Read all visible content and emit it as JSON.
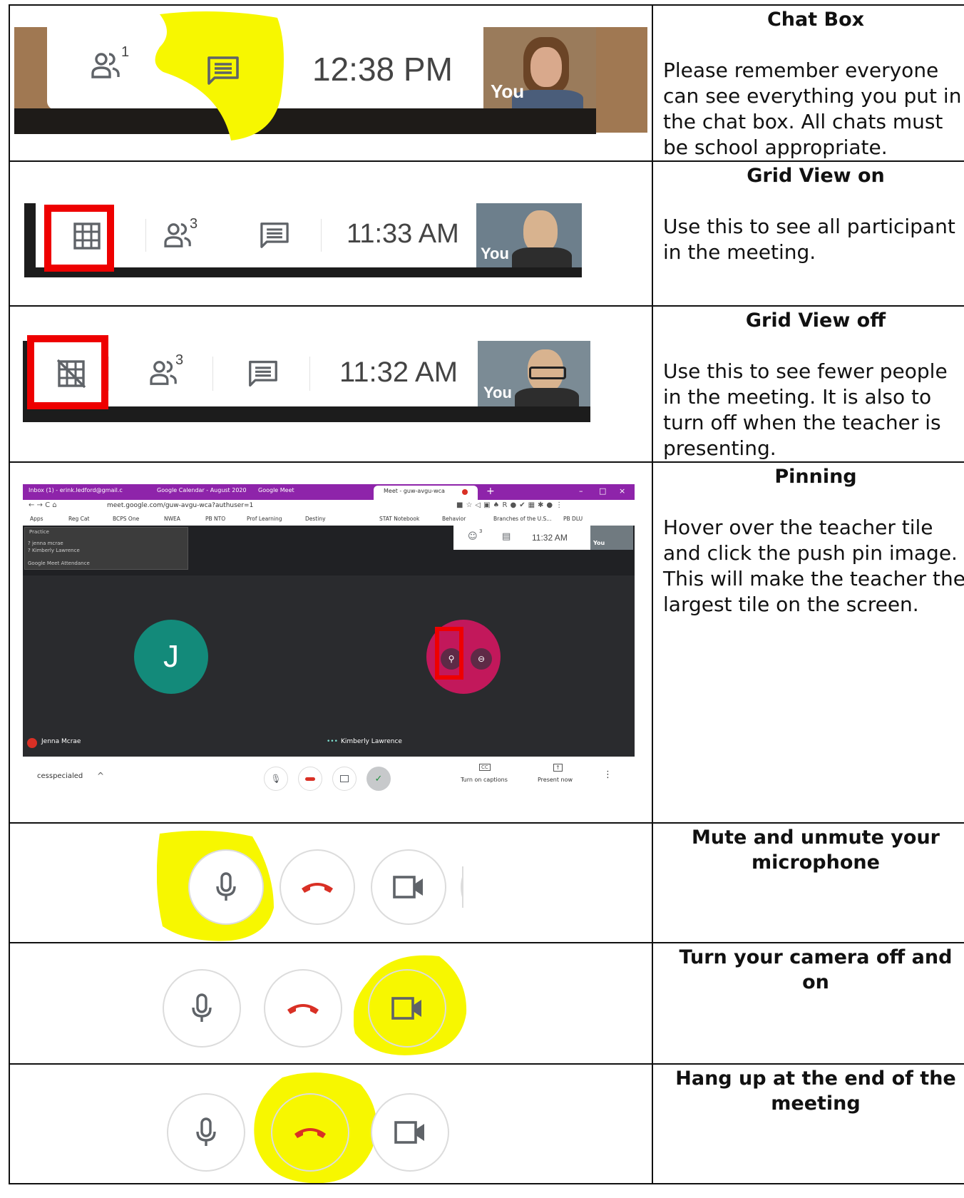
{
  "rows": [
    {
      "title": "Chat Box",
      "description": "Please remember everyone can see everything you put in the chat box.  All chats must be school appropriate.",
      "screenshot": {
        "participant_count": "1",
        "time": "12:38  PM",
        "self_label": "You"
      }
    },
    {
      "title": "Grid View on",
      "description": "Use this to see all participant in the meeting.",
      "screenshot": {
        "participant_count": "3",
        "time": "11:33  AM",
        "self_label": "You"
      }
    },
    {
      "title": "Grid View off",
      "description": "Use this to see fewer people in the meeting.  It is also to turn off when the teacher is presenting.",
      "screenshot": {
        "participant_count": "3",
        "time": "11:32  AM",
        "self_label": "You"
      }
    },
    {
      "title": "Pinning",
      "description": "Hover over the teacher tile and click the push pin image.  This will make the teacher the largest tile on the screen.",
      "screenshot": {
        "tabs": [
          "Inbox (1) - erink.ledford@gmail.c",
          "Google Calendar - August 2020",
          "Google Meet",
          "Meet - guw-avgu-wca"
        ],
        "url": "meet.google.com/guw-avgu-wca?authuser=1",
        "bookmarks": [
          "Apps",
          "Reg Cat",
          "BCPS One",
          "NWEA",
          "PB NTO",
          "Prof Learning",
          "Destiny",
          "STAT Notebook",
          "Behavior",
          "Branches of the U.S...",
          "PB DLU"
        ],
        "attendance_panel": [
          "Practice",
          "? jenna mcrae",
          "? Kimberly Lawrence",
          "Google Meet Attendance"
        ],
        "participant_count": "3",
        "time": "11:32  AM",
        "self_label": "You",
        "tile_left_initial": "J",
        "name_left": "Jenna Mcrae",
        "name_right": "Kimberly Lawrence",
        "meeting_name": "cesspecialed",
        "caption_label": "Turn on captions",
        "present_label": "Present now",
        "cc_label": "CC"
      }
    },
    {
      "title": "Mute and unmute your microphone",
      "description": ""
    },
    {
      "title": "Turn your camera off and on",
      "description": ""
    },
    {
      "title": "Hang up at the end of the meeting",
      "description": ""
    }
  ],
  "colors": {
    "highlight": "#f7f700",
    "annotation_red": "#ee0000",
    "hangup_red": "#d93025",
    "icon_grey": "#5f6368",
    "meet_dark": "#202124",
    "avatar_teal": "#138a7a",
    "avatar_pink": "#c2185b"
  },
  "icons": [
    "people-icon",
    "chat-icon",
    "grid-icon",
    "grid-off-icon",
    "mic-icon",
    "hangup-icon",
    "camera-icon",
    "pin-icon"
  ]
}
